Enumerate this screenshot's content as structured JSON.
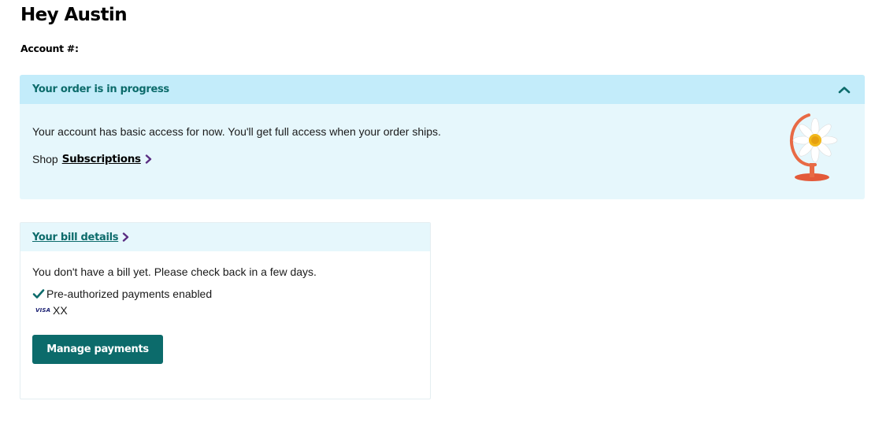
{
  "greeting": "Hey Austin",
  "account_label": "Account #:",
  "order": {
    "title": "Your order is in progress",
    "message": "Your account has basic access for now. You'll get full access when your order ships.",
    "shop_prefix": "Shop",
    "shop_link": "Subscriptions",
    "illustration": "daisy-globe-icon"
  },
  "bill": {
    "title": "Your bill details",
    "message": "You don't have a bill yet. Please check back in a few days.",
    "preauth": "Pre-authorized payments enabled",
    "card_brand": "VISA",
    "card_number": "XX",
    "manage_button": "Manage payments"
  },
  "colors": {
    "accent": "#0c6b6b",
    "panel_header": "#c3ecfa",
    "panel_bg": "#e6f7fc",
    "chevron": "#5a2d82"
  }
}
